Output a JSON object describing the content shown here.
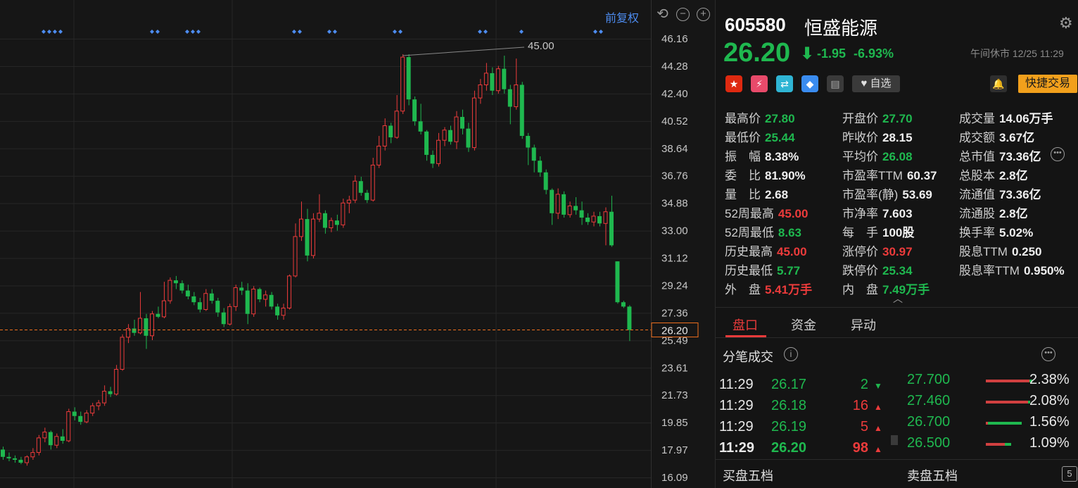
{
  "chart": {
    "adjust_label": "前复权",
    "y_ticks": [
      "46.16",
      "44.28",
      "42.40",
      "40.52",
      "38.64",
      "36.76",
      "34.88",
      "33.00",
      "31.12",
      "29.24",
      "27.36",
      "25.49",
      "23.61",
      "21.73",
      "19.85",
      "17.97",
      "16.09"
    ],
    "current_price_label": "26.20",
    "high_marker": "45.00",
    "colors": {
      "up": "#ec3b3b",
      "down": "#1fb84f",
      "marker": "#4d8cf0",
      "price_line": "#f0701e"
    }
  },
  "chart_data": {
    "type": "candlestick",
    "ylim": [
      16.09,
      46.16
    ],
    "current_price": 26.2,
    "max_marker": 45.0,
    "marker_groups": [
      4,
      2,
      3,
      2,
      2,
      2,
      2,
      1,
      2
    ],
    "candles": [
      [
        18.0,
        18.2,
        17.3,
        17.5
      ],
      [
        17.5,
        17.8,
        17.2,
        17.4
      ],
      [
        17.4,
        17.6,
        17.1,
        17.3
      ],
      [
        17.3,
        17.5,
        17.0,
        17.1
      ],
      [
        17.1,
        17.6,
        16.9,
        17.5
      ],
      [
        17.5,
        18.1,
        17.3,
        17.8
      ],
      [
        17.8,
        19.0,
        17.6,
        18.8
      ],
      [
        18.8,
        19.5,
        18.5,
        19.2
      ],
      [
        19.2,
        19.3,
        18.0,
        18.3
      ],
      [
        18.3,
        19.1,
        18.1,
        18.9
      ],
      [
        18.9,
        19.4,
        18.4,
        18.6
      ],
      [
        18.6,
        20.8,
        18.5,
        20.6
      ],
      [
        20.6,
        20.9,
        20.0,
        20.3
      ],
      [
        20.3,
        20.6,
        19.7,
        19.9
      ],
      [
        19.9,
        20.7,
        19.8,
        20.5
      ],
      [
        20.5,
        21.2,
        20.3,
        21.0
      ],
      [
        21.0,
        21.4,
        20.7,
        21.2
      ],
      [
        21.2,
        22.4,
        21.0,
        22.0
      ],
      [
        22.0,
        22.3,
        21.6,
        21.8
      ],
      [
        21.8,
        23.8,
        21.7,
        23.5
      ],
      [
        23.5,
        25.9,
        23.4,
        25.7
      ],
      [
        25.7,
        26.6,
        25.3,
        26.3
      ],
      [
        26.3,
        26.9,
        25.8,
        26.0
      ],
      [
        26.0,
        28.8,
        25.9,
        27.0
      ],
      [
        27.0,
        27.3,
        24.9,
        25.8
      ],
      [
        25.8,
        27.5,
        25.5,
        27.3
      ],
      [
        27.3,
        27.8,
        27.0,
        27.1
      ],
      [
        27.1,
        29.5,
        27.0,
        28.2
      ],
      [
        28.2,
        29.8,
        28.0,
        29.6
      ],
      [
        29.6,
        29.9,
        29.0,
        29.4
      ],
      [
        29.4,
        29.6,
        28.7,
        28.9
      ],
      [
        28.9,
        29.3,
        28.3,
        28.5
      ],
      [
        28.5,
        28.8,
        27.9,
        28.1
      ],
      [
        28.1,
        28.4,
        27.4,
        27.6
      ],
      [
        27.6,
        29.0,
        27.5,
        28.7
      ],
      [
        28.7,
        29.0,
        28.0,
        28.2
      ],
      [
        28.2,
        28.4,
        27.1,
        27.4
      ],
      [
        27.4,
        27.7,
        26.4,
        26.6
      ],
      [
        26.6,
        28.0,
        26.5,
        27.8
      ],
      [
        27.8,
        29.3,
        27.5,
        29.1
      ],
      [
        29.1,
        29.5,
        28.6,
        28.9
      ],
      [
        28.9,
        29.4,
        26.6,
        27.3
      ],
      [
        27.3,
        29.2,
        27.1,
        29.0
      ],
      [
        29.0,
        29.1,
        28.1,
        28.3
      ],
      [
        28.3,
        28.9,
        27.8,
        28.6
      ],
      [
        28.6,
        28.8,
        27.6,
        27.8
      ],
      [
        27.8,
        28.0,
        26.9,
        27.2
      ],
      [
        27.2,
        28.0,
        26.9,
        27.7
      ],
      [
        27.7,
        30.0,
        27.6,
        29.9
      ],
      [
        29.9,
        33.5,
        29.8,
        32.6
      ],
      [
        32.6,
        35.0,
        32.3,
        33.8
      ],
      [
        33.8,
        34.5,
        30.9,
        31.3
      ],
      [
        31.3,
        34.2,
        31.1,
        33.8
      ],
      [
        33.8,
        35.5,
        33.6,
        34.2
      ],
      [
        34.2,
        34.4,
        32.8,
        33.2
      ],
      [
        33.2,
        33.9,
        32.9,
        33.7
      ],
      [
        33.7,
        34.1,
        33.0,
        33.4
      ],
      [
        33.4,
        35.2,
        33.2,
        34.9
      ],
      [
        34.9,
        35.4,
        34.2,
        35.1
      ],
      [
        35.1,
        36.8,
        34.9,
        36.4
      ],
      [
        36.4,
        36.7,
        35.4,
        35.6
      ],
      [
        35.6,
        35.8,
        34.9,
        35.1
      ],
      [
        35.1,
        38.0,
        35.0,
        37.5
      ],
      [
        37.5,
        39.5,
        37.3,
        38.8
      ],
      [
        38.8,
        40.7,
        38.5,
        40.2
      ],
      [
        40.2,
        40.4,
        39.0,
        39.4
      ],
      [
        39.4,
        42.3,
        39.3,
        41.2
      ],
      [
        41.2,
        45.1,
        41.0,
        44.9
      ],
      [
        44.9,
        45.1,
        41.6,
        42.0
      ],
      [
        42.0,
        42.2,
        40.2,
        40.5
      ],
      [
        40.5,
        41.7,
        39.6,
        39.8
      ],
      [
        39.8,
        39.9,
        37.8,
        38.2
      ],
      [
        38.2,
        38.5,
        37.3,
        37.6
      ],
      [
        37.6,
        39.7,
        37.4,
        39.2
      ],
      [
        39.2,
        40.1,
        38.8,
        39.9
      ],
      [
        39.9,
        40.2,
        38.9,
        39.1
      ],
      [
        39.1,
        41.2,
        38.6,
        40.8
      ],
      [
        40.8,
        41.3,
        39.6,
        40.0
      ],
      [
        40.0,
        40.4,
        38.4,
        38.7
      ],
      [
        38.7,
        42.6,
        38.5,
        42.1
      ],
      [
        42.1,
        43.4,
        41.7,
        43.0
      ],
      [
        43.0,
        44.5,
        42.6,
        43.8
      ],
      [
        43.8,
        44.2,
        42.3,
        42.6
      ],
      [
        42.6,
        44.3,
        42.4,
        44.1
      ],
      [
        44.1,
        45.0,
        42.4,
        42.7
      ],
      [
        42.7,
        43.0,
        40.3,
        41.5
      ],
      [
        41.5,
        44.8,
        41.3,
        43.0
      ],
      [
        43.0,
        43.2,
        39.3,
        39.5
      ],
      [
        39.5,
        39.7,
        37.5,
        38.7
      ],
      [
        38.7,
        38.9,
        37.0,
        37.8
      ],
      [
        37.8,
        38.1,
        36.7,
        37.0
      ],
      [
        37.0,
        37.2,
        35.5,
        35.8
      ],
      [
        35.8,
        35.9,
        33.4,
        34.2
      ],
      [
        34.2,
        35.9,
        33.8,
        35.5
      ],
      [
        35.5,
        35.7,
        33.9,
        34.1
      ],
      [
        34.1,
        35.0,
        33.9,
        34.7
      ],
      [
        34.7,
        35.3,
        34.1,
        34.4
      ],
      [
        34.4,
        35.0,
        33.4,
        33.9
      ],
      [
        33.9,
        34.2,
        33.4,
        33.6
      ],
      [
        33.6,
        34.3,
        33.3,
        34.0
      ],
      [
        34.0,
        34.3,
        33.3,
        33.5
      ],
      [
        33.5,
        34.6,
        32.0,
        34.3
      ],
      [
        34.3,
        35.4,
        31.9,
        32.0
      ],
      [
        30.9,
        30.9,
        28.0,
        28.1
      ],
      [
        28.1,
        28.2,
        27.7,
        27.8
      ],
      [
        27.8,
        27.9,
        25.44,
        26.2
      ]
    ]
  },
  "stock": {
    "code": "605580",
    "name": "恒盛能源",
    "price": "26.20",
    "arrow": "⬇",
    "change": "-1.95",
    "change_pct": "-6.93%",
    "status": "午间休市 12/25 11:29"
  },
  "badges": {
    "watch_label": "自选",
    "quick_trade": "快捷交易"
  },
  "stats": [
    [
      {
        "k": "最高价",
        "v": "27.80",
        "c": "green"
      },
      {
        "k": "开盘价",
        "v": "27.70",
        "c": "green"
      },
      {
        "k": "成交量",
        "v": "14.06万手",
        "c": "white"
      }
    ],
    [
      {
        "k": "最低价",
        "v": "25.44",
        "c": "green"
      },
      {
        "k": "昨收价",
        "v": "28.15",
        "c": "white"
      },
      {
        "k": "成交额",
        "v": "3.67亿",
        "c": "white"
      }
    ],
    [
      {
        "k": "振　幅",
        "v": "8.38%",
        "c": "white"
      },
      {
        "k": "平均价",
        "v": "26.08",
        "c": "green"
      },
      {
        "k": "总市值",
        "v": "73.36亿",
        "c": "white"
      }
    ],
    [
      {
        "k": "委　比",
        "v": "81.90%",
        "c": "white"
      },
      {
        "k": "市盈率TTM",
        "v": "60.37",
        "c": "white"
      },
      {
        "k": "总股本",
        "v": "2.8亿",
        "c": "white"
      }
    ],
    [
      {
        "k": "量　比",
        "v": "2.68",
        "c": "white"
      },
      {
        "k": "市盈率(静)",
        "v": "53.69",
        "c": "white"
      },
      {
        "k": "流通值",
        "v": "73.36亿",
        "c": "white"
      }
    ],
    [
      {
        "k": "52周最高",
        "v": "45.00",
        "c": "red"
      },
      {
        "k": "市净率",
        "v": "7.603",
        "c": "white"
      },
      {
        "k": "流通股",
        "v": "2.8亿",
        "c": "white"
      }
    ],
    [
      {
        "k": "52周最低",
        "v": "8.63",
        "c": "green"
      },
      {
        "k": "每　手",
        "v": "100股",
        "c": "white"
      },
      {
        "k": "换手率",
        "v": "5.02%",
        "c": "white"
      }
    ],
    [
      {
        "k": "历史最高",
        "v": "45.00",
        "c": "red"
      },
      {
        "k": "涨停价",
        "v": "30.97",
        "c": "red"
      },
      {
        "k": "股息TTM",
        "v": "0.250",
        "c": "white"
      }
    ],
    [
      {
        "k": "历史最低",
        "v": "5.77",
        "c": "green"
      },
      {
        "k": "跌停价",
        "v": "25.34",
        "c": "green"
      },
      {
        "k": "股息率TTM",
        "v": "0.950%",
        "c": "white"
      }
    ],
    [
      {
        "k": "外　盘",
        "v": "5.41万手",
        "c": "red"
      },
      {
        "k": "内　盘",
        "v": "7.49万手",
        "c": "green"
      }
    ]
  ],
  "tabs": [
    "盘口",
    "资金",
    "异动"
  ],
  "ticks_section": {
    "title": "分笔成交",
    "rows": [
      {
        "time": "11:29",
        "price": "26.17",
        "vol": "2",
        "dir": "down"
      },
      {
        "time": "11:29",
        "price": "26.18",
        "vol": "16",
        "dir": "up"
      },
      {
        "time": "11:29",
        "price": "26.19",
        "vol": "5",
        "dir": "up"
      },
      {
        "time": "11:29",
        "price": "26.20",
        "vol": "98",
        "dir": "up"
      }
    ]
  },
  "distribution": [
    {
      "price": "27.700",
      "pct": "2.38%",
      "red": 0.86,
      "green": 0.06
    },
    {
      "price": "27.460",
      "pct": "2.08%",
      "red": 0.84,
      "green": 0.04
    },
    {
      "price": "26.700",
      "pct": "1.56%",
      "red": 0.04,
      "green": 0.66
    },
    {
      "price": "26.500",
      "pct": "1.09%",
      "red": 0.38,
      "green": 0.12
    }
  ],
  "bottom": {
    "buy_label": "买盘五档",
    "sell_label": "卖盘五档",
    "five": "5"
  }
}
